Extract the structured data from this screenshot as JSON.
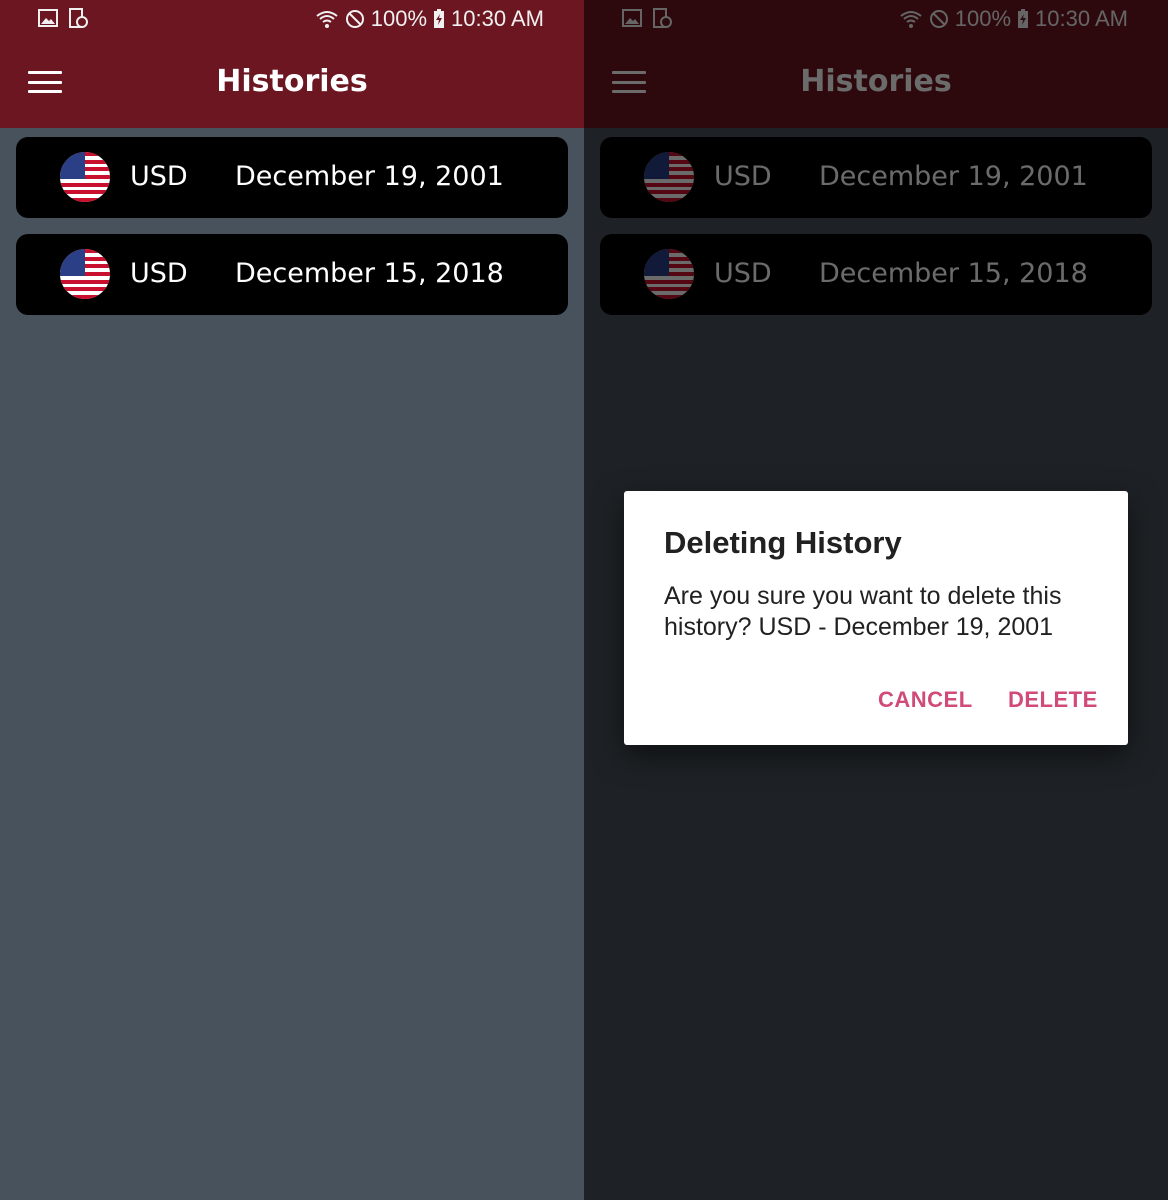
{
  "status": {
    "battery": "100%",
    "time": "10:30 AM"
  },
  "header": {
    "title": "Histories"
  },
  "histories": [
    {
      "currency": "USD",
      "date": "December 19, 2001",
      "flag": "us-flag-icon"
    },
    {
      "currency": "USD",
      "date": "December 15, 2018",
      "flag": "us-flag-icon"
    }
  ],
  "dialog": {
    "title": "Deleting History",
    "message": "Are you sure you want to delete this history? USD - December 19, 2001",
    "cancel_label": "CANCEL",
    "delete_label": "DELETE"
  },
  "colors": {
    "app_bar": "#6b1621",
    "background": "#48525c",
    "row": "#000000",
    "dialog_button": "#d04b78"
  }
}
